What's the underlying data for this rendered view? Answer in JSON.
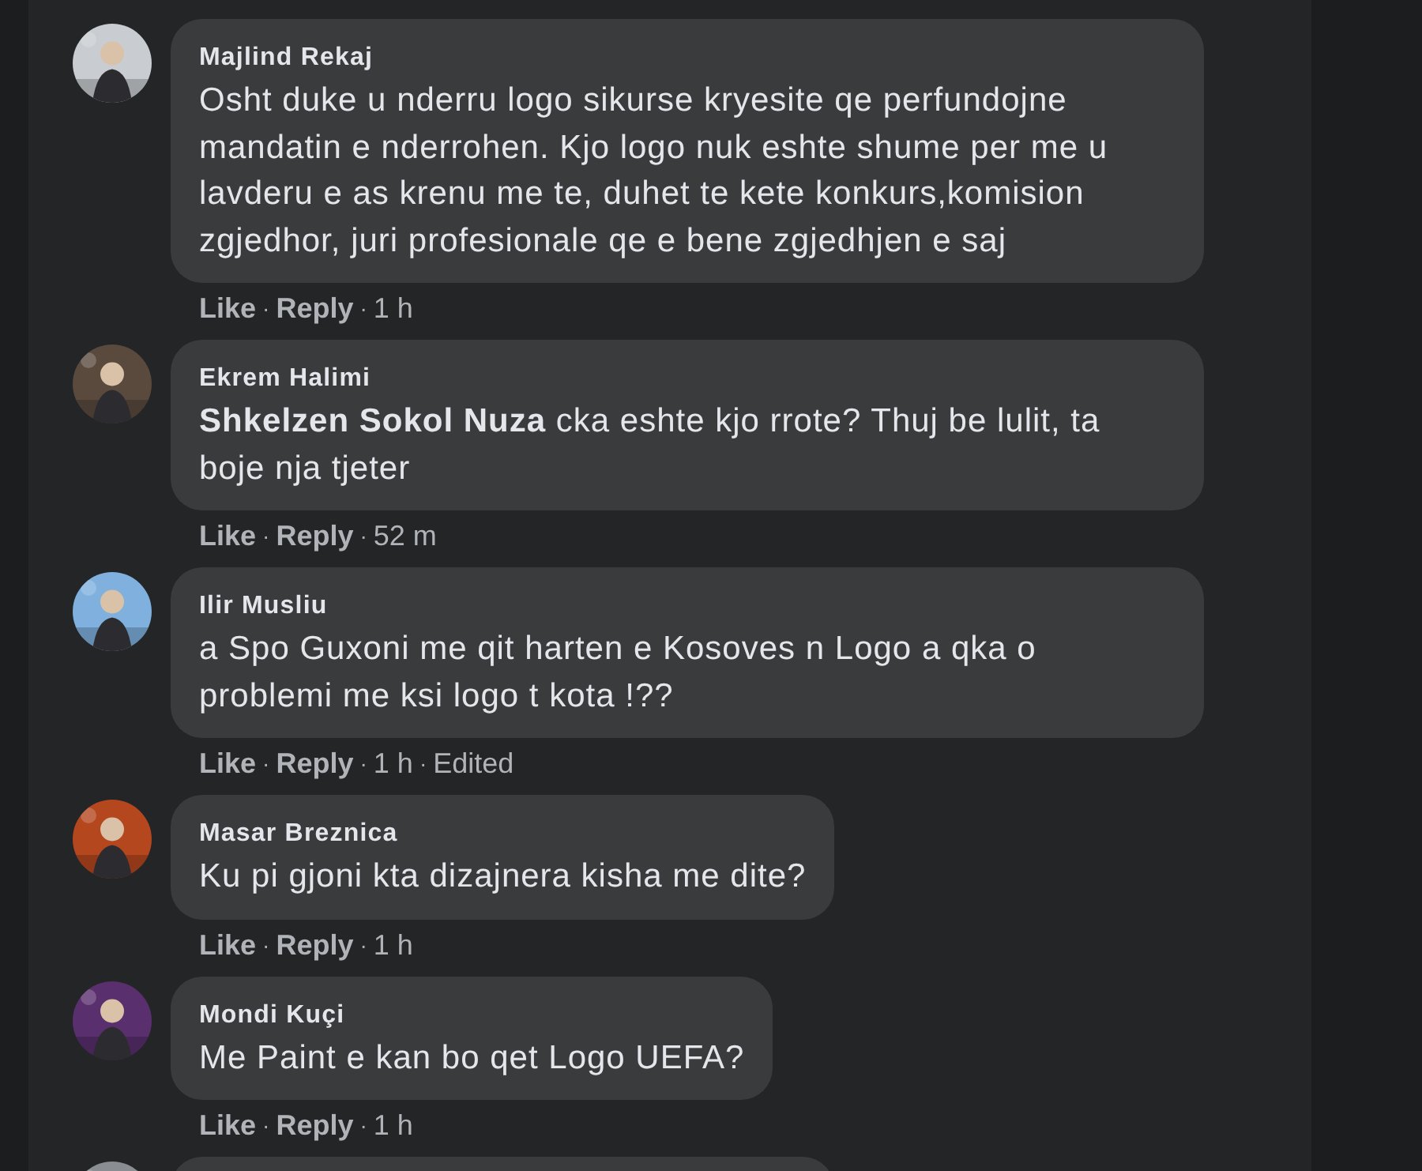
{
  "separator": "·",
  "comments": [
    {
      "kind": "comment",
      "author": "Majlind Rekaj",
      "text": "Osht duke u nderru logo sikurse kryesite qe perfundojne mandatin e nderrohen. Kjo logo nuk eshte shume per me u lavderu e as krenu me te, duhet te kete konkurs,komision zgjedhor, juri profesionale qe e bene zgjedhjen e saj",
      "actions": [
        "Like",
        "Reply"
      ],
      "time": "1 h"
    },
    {
      "kind": "comment",
      "author": "Ekrem Halimi",
      "text": "**Shkelzen Sokol Nuza** cka eshte kjo rrote? Thuj be lulit, ta boje nja tjeter",
      "actions": [
        "Like",
        "Reply"
      ],
      "time": "52 m"
    },
    {
      "kind": "comment",
      "author": "Ilir Musliu",
      "text": "a Spo Guxoni me qit harten e Kosoves n Logo a qka o problemi me ksi logo t kota !??",
      "actions": [
        "Like",
        "Reply"
      ],
      "time": "1 h",
      "note": "Edited"
    },
    {
      "kind": "comment",
      "author": "Masar Breznica",
      "text": "Ku pi gjoni kta dizajnera kisha me dite?",
      "actions": [
        "Like",
        "Reply"
      ],
      "time": "1 h"
    },
    {
      "kind": "comment",
      "author": "Mondi Kuçi",
      "text": "Me Paint e kan bo qet Logo UEFA?",
      "actions": [
        "Like",
        "Reply"
      ],
      "time": "1 h"
    },
    {
      "kind": "partial"
    }
  ]
}
